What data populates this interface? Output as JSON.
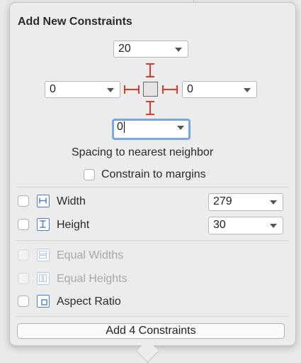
{
  "panel": {
    "title": "Add New Constraints",
    "top_value": "20",
    "left_value": "0",
    "right_value": "0",
    "bottom_value": "0",
    "spacing_label": "Spacing to nearest neighbor",
    "constrain_to_margins_label": "Constrain to margins",
    "width_label": "Width",
    "width_value": "279",
    "height_label": "Height",
    "height_value": "30",
    "equal_widths_label": "Equal Widths",
    "equal_heights_label": "Equal Heights",
    "aspect_ratio_label": "Aspect Ratio",
    "add_button_label": "Add 4 Constraints"
  },
  "colors": {
    "accent": "#4d7fd1",
    "focus_ring": "#7aa6e8",
    "constraint_red": "#e03a2e"
  }
}
